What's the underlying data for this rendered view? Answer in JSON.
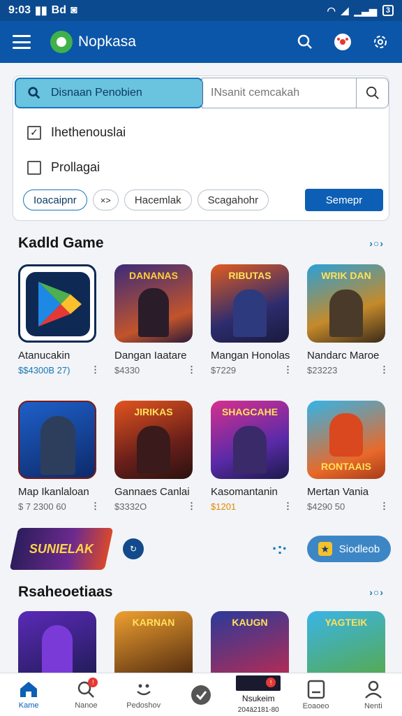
{
  "status": {
    "time": "9:03",
    "left_extra": "Bd",
    "battery": "3"
  },
  "app": {
    "title": "Nopkasa"
  },
  "search": {
    "scope_label": "Disnaan Penobien",
    "query_placeholder": "INsanit cemcakah",
    "checks": [
      {
        "label": "Ihethenouslai",
        "checked": true
      },
      {
        "label": "Prollagai",
        "checked": false
      }
    ],
    "chips": [
      {
        "label": "Ioacaipnr",
        "active": true
      },
      {
        "label": "Hacemlak",
        "active": false
      },
      {
        "label": "Scagahohr",
        "active": false
      }
    ],
    "chip_close": "×>",
    "submit_label": "Semepr"
  },
  "section1": {
    "title": "Kadld Game",
    "more": "›○›",
    "rows": [
      [
        {
          "name": "Atanucakin",
          "price": "$$4300B 27)",
          "price_color": "blue",
          "thumb": "play-store",
          "overlay": ""
        },
        {
          "name": "Dangan Iaatare",
          "price": "$4330",
          "price_color": "gray",
          "thumb": "warrior-purple",
          "overlay": "DANANAS"
        },
        {
          "name": "Mangan Honolas",
          "price": "$7229",
          "price_color": "gray",
          "thumb": "warrior-red",
          "overlay": "RIBUTAS"
        },
        {
          "name": "Nandarc Maroe",
          "price": "$23223",
          "price_color": "gray",
          "thumb": "warrior-gold",
          "overlay": "WRIK DAN"
        }
      ],
      [
        {
          "name": "Map Ikanlaloan",
          "price": "$ 7 2300 60",
          "price_color": "gray",
          "thumb": "knight-blue",
          "overlay": ""
        },
        {
          "name": "Gannaes Canlai",
          "price": "$3332O",
          "price_color": "gray",
          "thumb": "warrior-dark",
          "overlay": "JIRIKAS"
        },
        {
          "name": "Kasomantanin",
          "price": "$1201",
          "price_color": "orange",
          "thumb": "neon-fighter",
          "overlay": "SHAGCAHE"
        },
        {
          "name": "Mertan Vania",
          "price": "$4290 50",
          "price_color": "gray",
          "thumb": "cartoon-hero",
          "overlay": "RONTAAIS"
        }
      ]
    ]
  },
  "banner": {
    "logo_text": "SUNIELAK",
    "badge": "↻",
    "dots": "·:·",
    "button_label": "Siodleob"
  },
  "section2": {
    "title": "Rsaheoetiaas",
    "more": "›○›",
    "cards": [
      {
        "thumb": "mage-purple",
        "overlay": ""
      },
      {
        "thumb": "dark-hero",
        "overlay": "KARNAN"
      },
      {
        "thumb": "team-red",
        "overlay": "KAUGN"
      },
      {
        "thumb": "blocky",
        "overlay": "YAGTEIK"
      }
    ]
  },
  "nav": {
    "items": [
      {
        "label": "Kame",
        "active": true,
        "badge": ""
      },
      {
        "label": "Nanoe",
        "active": false,
        "badge": "!"
      },
      {
        "label": "Pedoshov",
        "active": false,
        "badge": ""
      },
      {
        "label": "",
        "active": false,
        "badge": ""
      },
      {
        "label": "Nsukeim",
        "sublabel": "204ā2181-80",
        "active": false,
        "badge": "!"
      },
      {
        "label": "Eoaoeo",
        "active": false,
        "badge": ""
      },
      {
        "label": "Nenti",
        "active": false,
        "badge": ""
      }
    ]
  },
  "colors": {
    "appbar": "#0b56a8",
    "accent": "#0c5fb4",
    "chip_active": "#1876b6"
  }
}
